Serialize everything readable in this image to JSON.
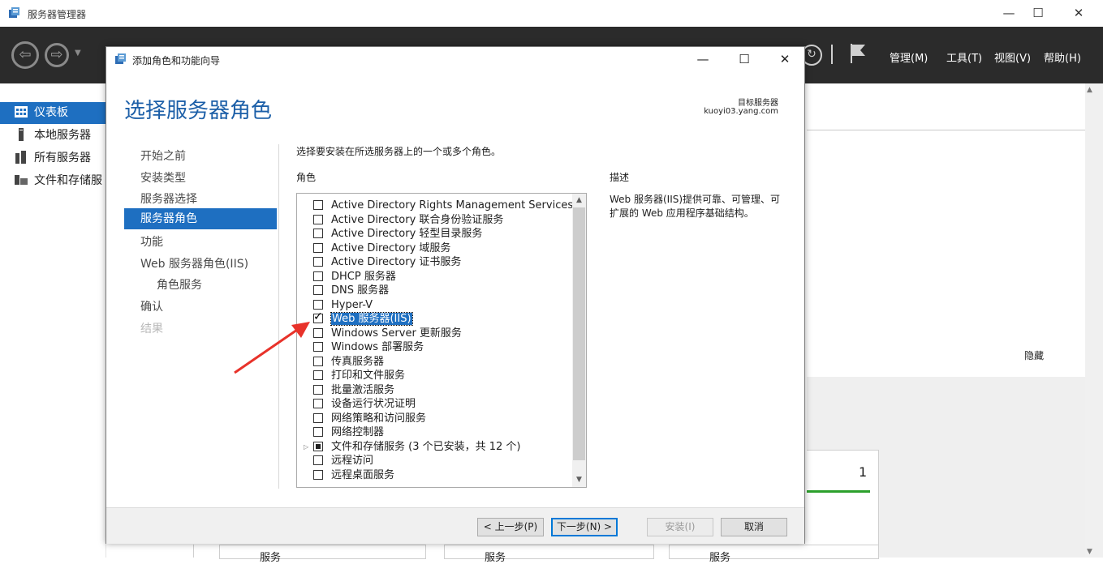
{
  "main_window": {
    "title": "服务器管理器",
    "menu": [
      "管理(M)",
      "工具(T)",
      "视图(V)",
      "帮助(H)"
    ]
  },
  "left_nav": {
    "items": [
      {
        "label": "仪表板",
        "icon": "dashboard-icon",
        "selected": true
      },
      {
        "label": "本地服务器",
        "icon": "local-server-icon",
        "selected": false
      },
      {
        "label": "所有服务器",
        "icon": "all-servers-icon",
        "selected": false
      },
      {
        "label": "文件和存储服",
        "icon": "file-storage-icon",
        "selected": false
      }
    ]
  },
  "background": {
    "hide_link": "隐藏",
    "tile_count": "1",
    "service_labels": [
      "服务",
      "服务",
      "服务"
    ]
  },
  "dialog": {
    "title": "添加角色和功能向导",
    "heading": "选择服务器角色",
    "target_label": "目标服务器",
    "target_value": "kuoyi03.yang.com",
    "steps": [
      {
        "label": "开始之前",
        "state": "normal"
      },
      {
        "label": "安装类型",
        "state": "normal"
      },
      {
        "label": "服务器选择",
        "state": "normal"
      },
      {
        "label": "服务器角色",
        "state": "active"
      },
      {
        "label": "功能",
        "state": "normal"
      },
      {
        "label": "Web 服务器角色(IIS)",
        "state": "normal"
      },
      {
        "label": "角色服务",
        "state": "sub"
      },
      {
        "label": "确认",
        "state": "normal"
      },
      {
        "label": "结果",
        "state": "disabled"
      }
    ],
    "instruction": "选择要安装在所选服务器上的一个或多个角色。",
    "roles_label": "角色",
    "description_label": "描述",
    "description": "Web 服务器(IIS)提供可靠、可管理、可扩展的 Web 应用程序基础结构。",
    "roles": [
      {
        "label": "Active Directory Rights Management Services",
        "state": "unchecked"
      },
      {
        "label": "Active Directory 联合身份验证服务",
        "state": "unchecked"
      },
      {
        "label": "Active Directory 轻型目录服务",
        "state": "unchecked"
      },
      {
        "label": "Active Directory 域服务",
        "state": "unchecked"
      },
      {
        "label": "Active Directory 证书服务",
        "state": "unchecked"
      },
      {
        "label": "DHCP 服务器",
        "state": "unchecked"
      },
      {
        "label": "DNS 服务器",
        "state": "unchecked"
      },
      {
        "label": "Hyper-V",
        "state": "unchecked"
      },
      {
        "label": "Web 服务器(IIS)",
        "state": "checked"
      },
      {
        "label": "Windows Server 更新服务",
        "state": "unchecked"
      },
      {
        "label": "Windows 部署服务",
        "state": "unchecked"
      },
      {
        "label": "传真服务器",
        "state": "unchecked"
      },
      {
        "label": "打印和文件服务",
        "state": "unchecked"
      },
      {
        "label": "批量激活服务",
        "state": "unchecked"
      },
      {
        "label": "设备运行状况证明",
        "state": "unchecked"
      },
      {
        "label": "网络策略和访问服务",
        "state": "unchecked"
      },
      {
        "label": "网络控制器",
        "state": "unchecked"
      },
      {
        "label": "文件和存储服务 (3 个已安装，共 12 个)",
        "state": "partial"
      },
      {
        "label": "远程访问",
        "state": "unchecked"
      },
      {
        "label": "远程桌面服务",
        "state": "unchecked"
      }
    ],
    "buttons": {
      "prev": "< 上一步(P)",
      "next": "下一步(N) >",
      "install": "安装(I)",
      "cancel": "取消"
    }
  },
  "colors": {
    "accent": "#1e6fc1",
    "heading": "#1c5fa8",
    "toolbar": "#2b2b2b",
    "arrow": "#e8322a"
  }
}
